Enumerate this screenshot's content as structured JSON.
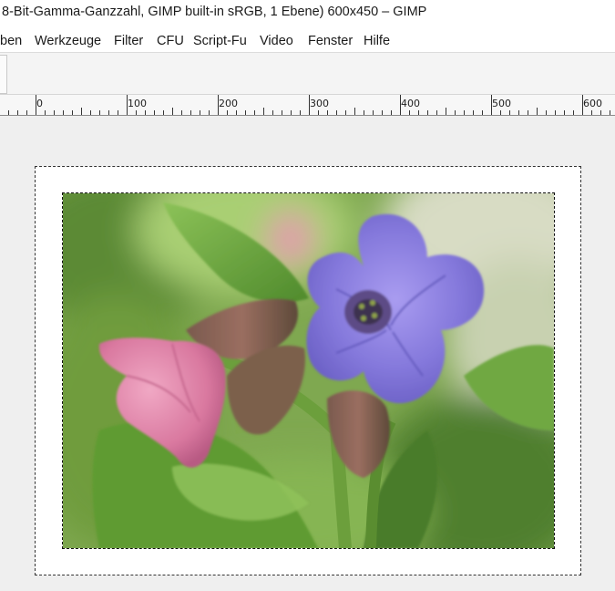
{
  "window": {
    "title": "8-Bit-Gamma-Ganzzahl, GIMP built-in sRGB, 1 Ebene) 600x450 – GIMP"
  },
  "menubar": {
    "items": [
      "ben",
      "Werkzeuge",
      "Filter",
      "CFU",
      "Script-Fu",
      "Video",
      "Fenster",
      "Hilfe"
    ]
  },
  "ruler": {
    "labels": [
      "0",
      "100",
      "200",
      "300",
      "400",
      "500",
      "600"
    ]
  },
  "colors": {
    "menubar_bg": "#ffffff",
    "canvas_bg": "#efefef",
    "flower_blue": "#7e74d6",
    "flower_pink": "#d97aa0",
    "leaf_green": "#6fa843"
  }
}
